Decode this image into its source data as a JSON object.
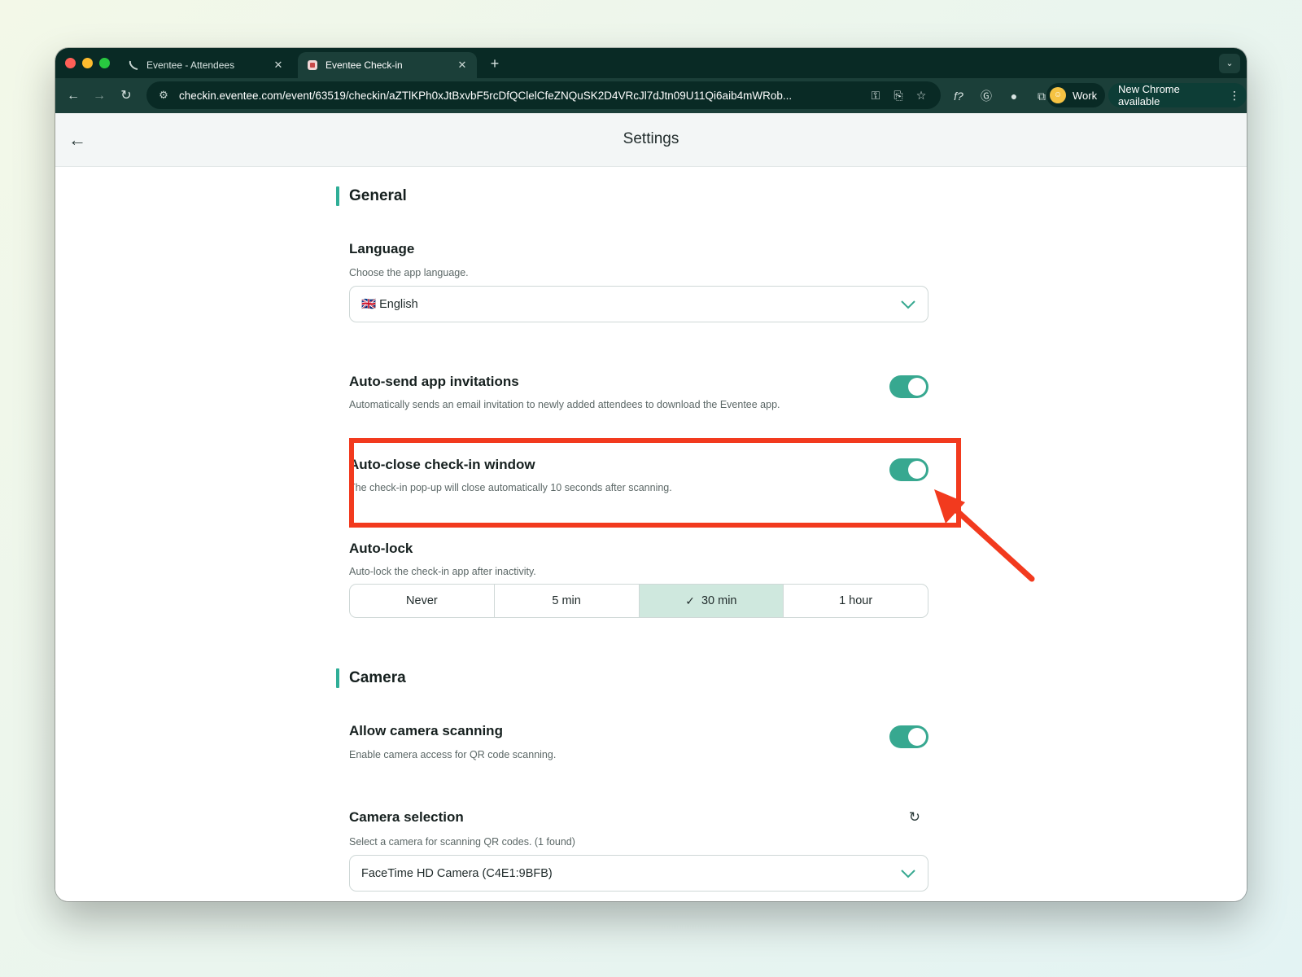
{
  "browser": {
    "tabs": [
      {
        "title": "Eventee - Attendees",
        "active": false
      },
      {
        "title": "Eventee Check-in",
        "active": true
      }
    ],
    "url": "checkin.eventee.com/event/63519/checkin/aZTlKPh0xJtBxvbF5rcDfQClelCfeZNQuSK2D4VRcJl7dJtn09U11Qi6aib4mWRob...",
    "profile_label": "Work",
    "update_label": "New Chrome available"
  },
  "header": {
    "title": "Settings"
  },
  "general": {
    "title": "General",
    "language": {
      "label": "Language",
      "description": "Choose the app language.",
      "value": "🇬🇧 English"
    },
    "auto_send": {
      "label": "Auto-send app invitations",
      "description": "Automatically sends an email invitation to newly added attendees to download the Eventee app.",
      "enabled": true
    },
    "auto_close": {
      "label": "Auto-close check-in window",
      "description": "The check-in pop-up will close automatically 10 seconds after scanning.",
      "enabled": true
    },
    "auto_lock": {
      "label": "Auto-lock",
      "description": "Auto-lock the check-in app after inactivity.",
      "options": [
        "Never",
        "5 min",
        "30 min",
        "1 hour"
      ],
      "selected": "30 min"
    }
  },
  "camera": {
    "title": "Camera",
    "allow_scanning": {
      "label": "Allow camera scanning",
      "description": "Enable camera access for QR code scanning.",
      "enabled": true
    },
    "selection": {
      "label": "Camera selection",
      "description": "Select a camera for scanning QR codes. (1 found)",
      "value": "FaceTime HD Camera (C4E1:9BFB)"
    }
  },
  "colors": {
    "accent": "#37a890",
    "annotation": "#f23a1e",
    "toolbar": "#1b3f39",
    "tabstrip": "#092a25"
  }
}
